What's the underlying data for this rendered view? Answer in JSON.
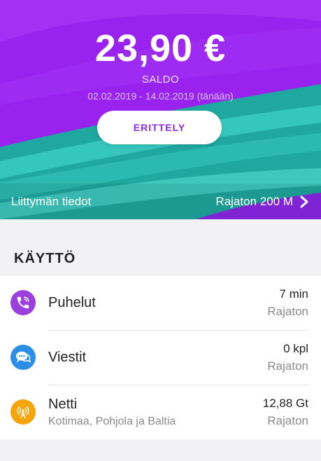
{
  "header": {
    "amount": "23,90 €",
    "saldo_label": "SALDO",
    "period": "02.02.2019 - 14.02.2019 (tänään)",
    "erittely_button": "ERITTELY",
    "subscription_label": "Liittymän tiedot",
    "subscription_value": "Rajaton 200 M"
  },
  "usage": {
    "title": "KÄYTTÖ",
    "items": [
      {
        "icon": "phone-icon",
        "name": "Puhelut",
        "subtitle": "",
        "value": "7 min",
        "limit": "Rajaton",
        "icon_color": "#9b3fe0"
      },
      {
        "icon": "chat-icon",
        "name": "Viestit",
        "subtitle": "",
        "value": "0 kpl",
        "limit": "Rajaton",
        "icon_color": "#2a8ee8"
      },
      {
        "icon": "antenna-icon",
        "name": "Netti",
        "subtitle": "Kotimaa, Pohjola ja Baltia",
        "value": "12,88 Gt",
        "limit": "Rajaton",
        "icon_color": "#f5a40c"
      }
    ]
  },
  "colors": {
    "purple": "#9a24f0",
    "teal": "#27b7b0",
    "accent_text": "#8a2be2"
  }
}
